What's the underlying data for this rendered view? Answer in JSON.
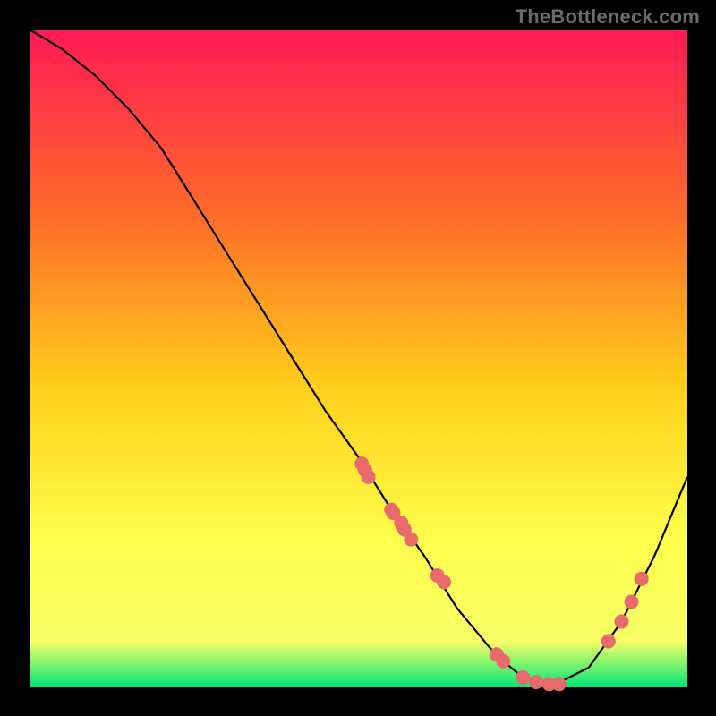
{
  "watermark": "TheBottleneck.com",
  "colors": {
    "bg_black": "#000000",
    "grad_top": "#ff1a55",
    "grad_mid1": "#ff6a2a",
    "grad_mid2": "#ffd11a",
    "grad_mid3": "#ffff4d",
    "grad_bottom_yellow": "#f7ff66",
    "grad_green": "#00e676",
    "line": "#000000",
    "marker": "#e96a6a",
    "watermark": "#6b6b6b"
  },
  "chart_data": {
    "type": "line",
    "title": "",
    "xlabel": "",
    "ylabel": "",
    "xlim": [
      0,
      100
    ],
    "ylim": [
      0,
      100
    ],
    "grid": false,
    "legend": false,
    "annotations": [],
    "series": [
      {
        "name": "curve",
        "x": [
          0,
          5,
          10,
          15,
          20,
          25,
          30,
          35,
          40,
          45,
          50,
          55,
          60,
          65,
          70,
          72,
          75,
          80,
          85,
          90,
          95,
          100
        ],
        "y": [
          100,
          97,
          93,
          88,
          82,
          74,
          66,
          58,
          50,
          42,
          35,
          27,
          20,
          12,
          6,
          4,
          1.5,
          0.5,
          3,
          10,
          20,
          32
        ]
      }
    ],
    "markers": {
      "name": "dots",
      "x": [
        50.5,
        51,
        51.5,
        55,
        55.3,
        56.5,
        57,
        58,
        62,
        63,
        71,
        72,
        75,
        77,
        79,
        80.5,
        88,
        90,
        91.5,
        93
      ],
      "y": [
        34,
        33,
        32,
        27,
        26.5,
        25,
        24,
        22.5,
        17,
        16,
        5,
        4,
        1.5,
        0.8,
        0.5,
        0.5,
        7,
        10,
        13,
        16.5
      ]
    }
  }
}
